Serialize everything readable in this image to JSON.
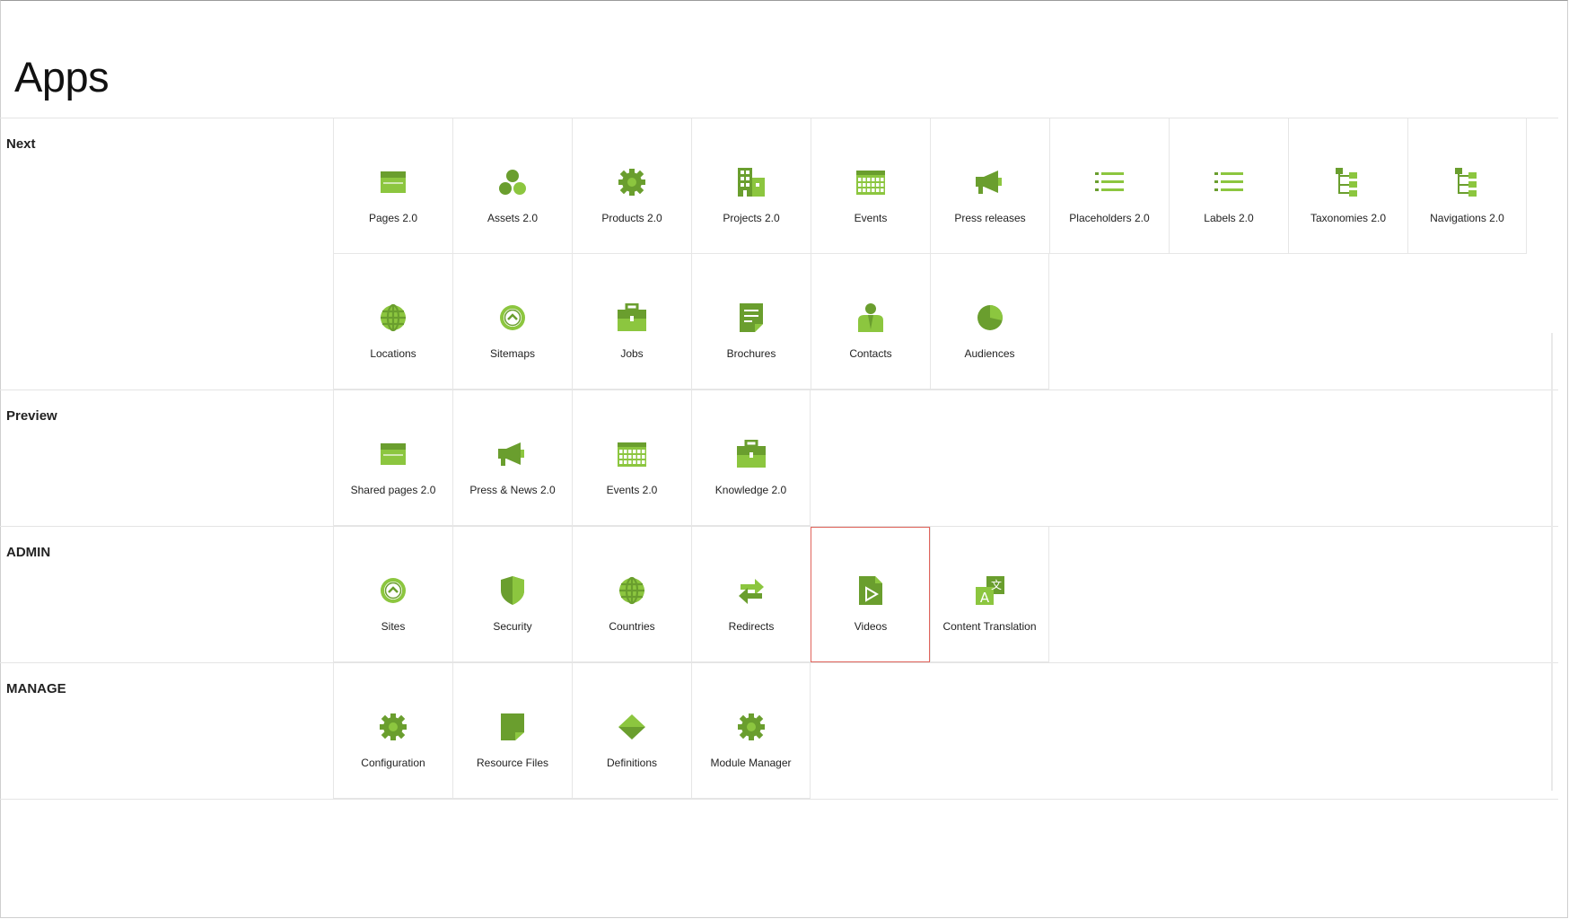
{
  "page": {
    "title": "Apps"
  },
  "colors": {
    "accent": "#6a9e2e",
    "light": "#8cc63f",
    "selected_border": "#e0645c"
  },
  "sections": [
    {
      "label": "Next",
      "items": [
        {
          "label": "Pages 2.0",
          "icon": "page-icon"
        },
        {
          "label": "Assets 2.0",
          "icon": "assets-icon"
        },
        {
          "label": "Products 2.0",
          "icon": "gear-icon"
        },
        {
          "label": "Projects 2.0",
          "icon": "building-icon"
        },
        {
          "label": "Events",
          "icon": "calendar-icon"
        },
        {
          "label": "Press releases",
          "icon": "megaphone-icon"
        },
        {
          "label": "Placeholders 2.0",
          "icon": "list-icon"
        },
        {
          "label": "Labels 2.0",
          "icon": "list-icon"
        },
        {
          "label": "Taxonomies 2.0",
          "icon": "tree-icon"
        },
        {
          "label": "Navigations 2.0",
          "icon": "tree-icon"
        },
        {
          "label": "Locations",
          "icon": "globe-icon"
        },
        {
          "label": "Sitemaps",
          "icon": "chevron-circle-icon"
        },
        {
          "label": "Jobs",
          "icon": "briefcase-icon"
        },
        {
          "label": "Brochures",
          "icon": "document-icon"
        },
        {
          "label": "Contacts",
          "icon": "person-icon"
        },
        {
          "label": "Audiences",
          "icon": "pie-icon"
        }
      ]
    },
    {
      "label": "Preview",
      "items": [
        {
          "label": "Shared pages 2.0",
          "icon": "page-icon"
        },
        {
          "label": "Press & News 2.0",
          "icon": "megaphone-icon"
        },
        {
          "label": "Events 2.0",
          "icon": "calendar-icon"
        },
        {
          "label": "Knowledge 2.0",
          "icon": "briefcase-icon"
        }
      ]
    },
    {
      "label": "ADMIN",
      "items": [
        {
          "label": "Sites",
          "icon": "chevron-circle-icon"
        },
        {
          "label": "Security",
          "icon": "shield-icon"
        },
        {
          "label": "Countries",
          "icon": "globe-icon"
        },
        {
          "label": "Redirects",
          "icon": "redirect-icon"
        },
        {
          "label": "Videos",
          "icon": "video-icon",
          "selected": true
        },
        {
          "label": "Content Translation",
          "icon": "translate-icon"
        }
      ]
    },
    {
      "label": "MANAGE",
      "items": [
        {
          "label": "Configuration",
          "icon": "gear-icon"
        },
        {
          "label": "Resource Files",
          "icon": "file-icon"
        },
        {
          "label": "Definitions",
          "icon": "diamond-icon"
        },
        {
          "label": "Module Manager",
          "icon": "gear-icon"
        }
      ]
    }
  ]
}
